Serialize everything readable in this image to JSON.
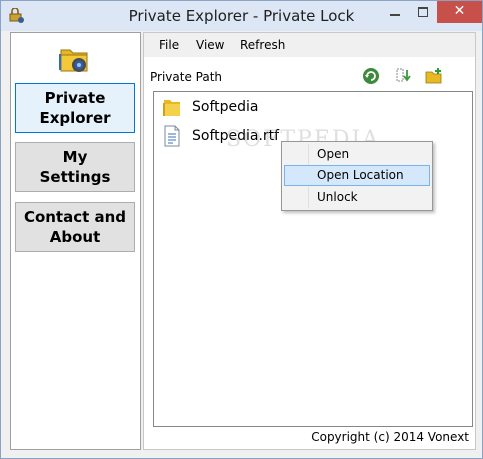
{
  "window": {
    "title": "Private Explorer - Private Lock",
    "close_glyph": "✕"
  },
  "sidebar": {
    "items": [
      {
        "label_line1": "Private",
        "label_line2": "Explorer",
        "active": true
      },
      {
        "label_line1": "My",
        "label_line2": "Settings",
        "active": false
      },
      {
        "label_line1": "Contact and",
        "label_line2": "About",
        "active": false
      }
    ]
  },
  "menubar": {
    "items": [
      "File",
      "View",
      "Refresh"
    ]
  },
  "main": {
    "path_label": "Private Path",
    "files": [
      {
        "name": "Softpedia",
        "type": "folder"
      },
      {
        "name": "Softpedia.rtf",
        "type": "document"
      }
    ],
    "copyright": "Copyright (c) 2014 Vonext"
  },
  "context_menu": {
    "items": [
      "Open",
      "Open Location",
      "Unlock"
    ],
    "highlighted": "Open Location"
  },
  "watermark": "SOFTPEDIA",
  "colors": {
    "accent": "#0078d7",
    "close": "#c7504b",
    "titlebar": "#dce6f4"
  }
}
